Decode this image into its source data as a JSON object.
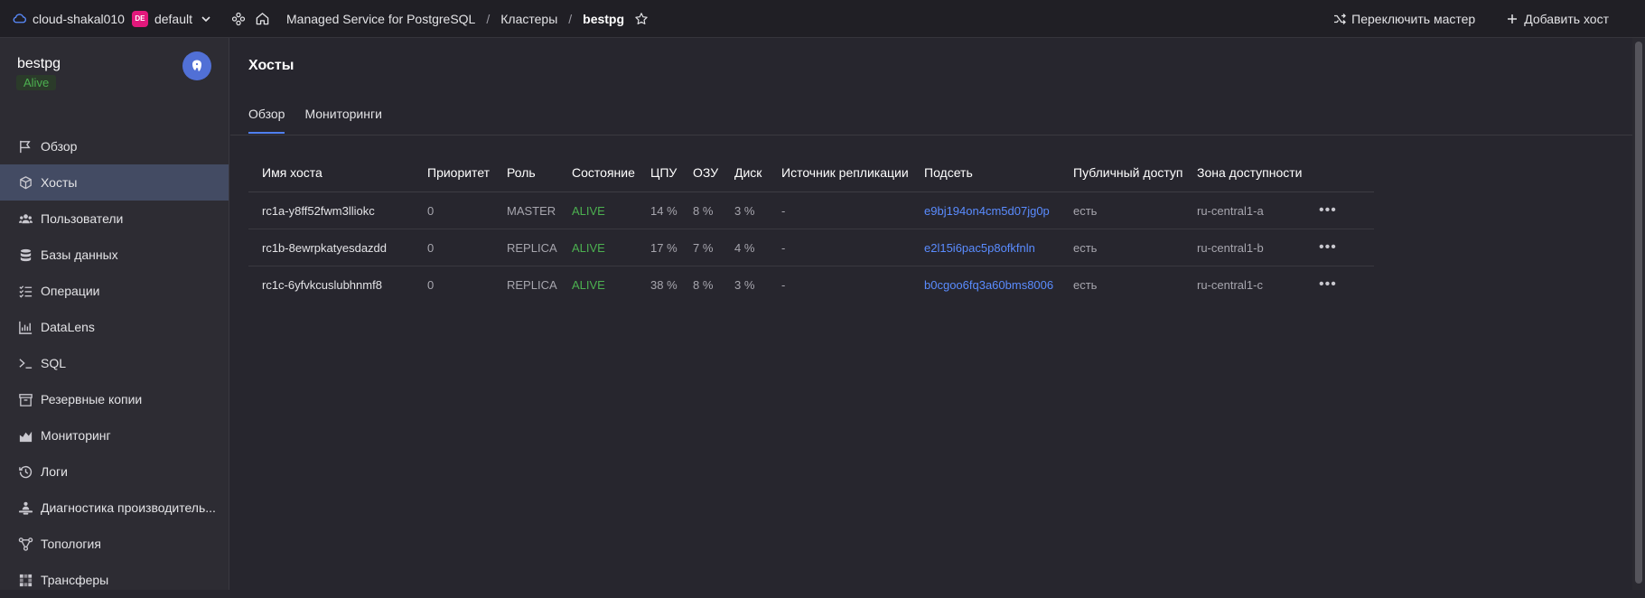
{
  "topbar": {
    "cloud": "cloud-shakal010",
    "folder_badge": "DE",
    "folder": "default",
    "breadcrumbs": [
      "Managed Service for PostgreSQL",
      "Кластеры",
      "bestpg"
    ],
    "actions": {
      "switch_master": "Переключить мастер",
      "add_host": "Добавить хост"
    }
  },
  "sidebar": {
    "cluster_name": "bestpg",
    "status": "Alive",
    "items": [
      {
        "label": "Обзор",
        "icon": "flag-icon"
      },
      {
        "label": "Хосты",
        "icon": "cube-icon"
      },
      {
        "label": "Пользователи",
        "icon": "users-icon"
      },
      {
        "label": "Базы данных",
        "icon": "database-icon"
      },
      {
        "label": "Операции",
        "icon": "list-check-icon"
      },
      {
        "label": "DataLens",
        "icon": "chart-icon"
      },
      {
        "label": "SQL",
        "icon": "terminal-icon"
      },
      {
        "label": "Резервные копии",
        "icon": "archive-icon"
      },
      {
        "label": "Мониторинг",
        "icon": "area-chart-icon"
      },
      {
        "label": "Логи",
        "icon": "history-icon"
      },
      {
        "label": "Диагностика производитель...",
        "icon": "diagnostics-icon"
      },
      {
        "label": "Топология",
        "icon": "topology-icon"
      },
      {
        "label": "Трансферы",
        "icon": "transfer-icon"
      }
    ],
    "active_index": 1
  },
  "main": {
    "title": "Хосты",
    "tabs": [
      "Обзор",
      "Мониторинги"
    ],
    "active_tab": 0,
    "table": {
      "headers": [
        "Имя хоста",
        "Приоритет",
        "Роль",
        "Состояние",
        "ЦПУ",
        "ОЗУ",
        "Диск",
        "Источник репликации",
        "Подсеть",
        "Публичный доступ",
        "Зона доступности"
      ],
      "rows": [
        {
          "host": "rc1a-y8ff52fwm3lliokc",
          "priority": "0",
          "role": "MASTER",
          "state": "ALIVE",
          "cpu": "14 %",
          "ram": "8 %",
          "disk": "3 %",
          "source": "-",
          "subnet": "e9bj194on4cm5d07jg0p",
          "public": "есть",
          "zone": "ru-central1-a"
        },
        {
          "host": "rc1b-8ewrpkatyesdazdd",
          "priority": "0",
          "role": "REPLICA",
          "state": "ALIVE",
          "cpu": "17 %",
          "ram": "7 %",
          "disk": "4 %",
          "source": "-",
          "subnet": "e2l15i6pac5p8ofkfnln",
          "public": "есть",
          "zone": "ru-central1-b"
        },
        {
          "host": "rc1c-6yfvkcuslubhnmf8",
          "priority": "0",
          "role": "REPLICA",
          "state": "ALIVE",
          "cpu": "38 %",
          "ram": "8 %",
          "disk": "3 %",
          "source": "-",
          "subnet": "b0cgoo6fq3a60bms8006",
          "public": "есть",
          "zone": "ru-central1-c"
        }
      ]
    }
  },
  "colors": {
    "accent": "#4f7ff0",
    "alive": "#4cb050",
    "link": "#5a8cff",
    "badge": "#e2187c"
  }
}
